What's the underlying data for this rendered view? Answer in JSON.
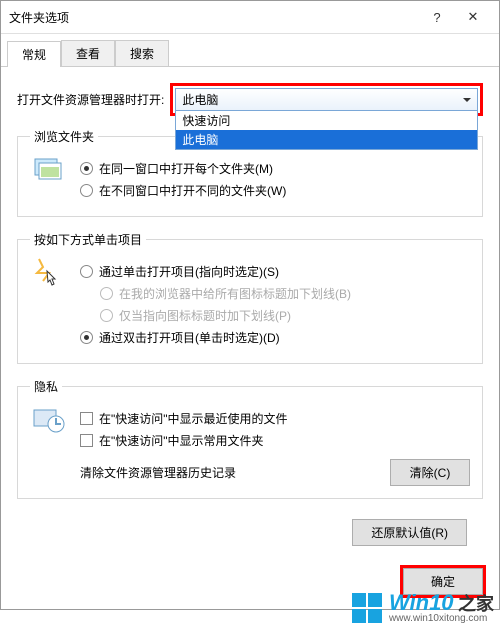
{
  "title": "文件夹选项",
  "tabs": {
    "general": "常规",
    "view": "查看",
    "search": "搜索"
  },
  "openWith": {
    "label": "打开文件资源管理器时打开:",
    "selected": "此电脑",
    "options": [
      "快速访问",
      "此电脑"
    ]
  },
  "browse": {
    "legend": "浏览文件夹",
    "sameWin": "在同一窗口中打开每个文件夹(M)",
    "ownWin": "在不同窗口中打开不同的文件夹(W)"
  },
  "click": {
    "legend": "按如下方式单击项目",
    "single": "通过单击打开项目(指向时选定)(S)",
    "u1": "在我的浏览器中给所有图标标题加下划线(B)",
    "u2": "仅当指向图标标题时加下划线(P)",
    "double": "通过双击打开项目(单击时选定)(D)"
  },
  "privacy": {
    "legend": "隐私",
    "recent": "在\"快速访问\"中显示最近使用的文件",
    "freq": "在\"快速访问\"中显示常用文件夹",
    "clearLabel": "清除文件资源管理器历史记录",
    "clearBtn": "清除(C)"
  },
  "buttons": {
    "restore": "还原默认值(R)",
    "ok": "确定"
  },
  "watermark": {
    "brand": "Win10",
    "suffix": "之家",
    "url": "www.win10xitong.com"
  }
}
